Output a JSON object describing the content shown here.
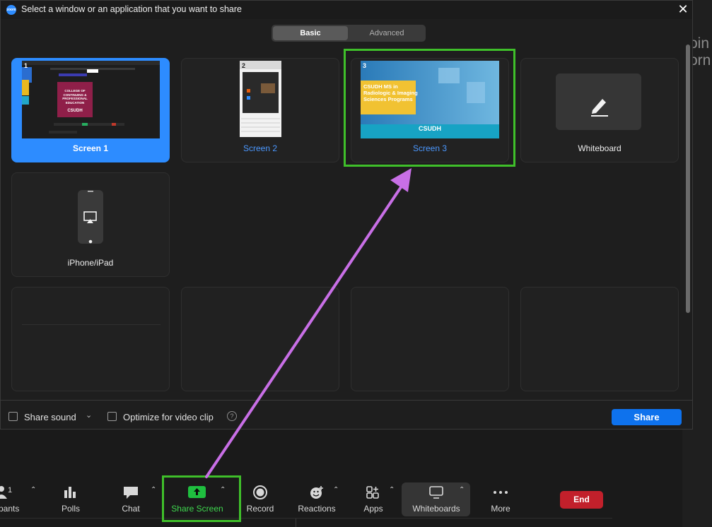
{
  "dialog": {
    "title": "Select a window or an application that you want to share",
    "app_icon_text": "zoom",
    "close_glyph": "✕",
    "tabs": [
      {
        "label": "Basic",
        "selected": true
      },
      {
        "label": "Advanced",
        "selected": false
      }
    ],
    "tiles": [
      {
        "label": "Screen 1",
        "number": "1",
        "selected": true
      },
      {
        "label": "Screen 2",
        "number": "2",
        "selected": false
      },
      {
        "label": "Screen 3",
        "number": "3",
        "selected": false
      },
      {
        "label": "Whiteboard",
        "selected": false
      },
      {
        "label": "iPhone/iPad",
        "selected": false
      }
    ],
    "screen1_thumb": {
      "slide_text": "COLLEGE OF CONTINUING & PROFESSIONAL EDUCATION",
      "logo": "CSUDH"
    },
    "screen3_thumb": {
      "headline": "CSUDH MS in Radiologic & Imaging Sciences Programs",
      "logo": "CSUDH"
    },
    "footer": {
      "share_sound_label": "Share sound",
      "share_sound_checked": false,
      "optimize_label": "Optimize for video clip",
      "optimize_checked": false,
      "help_glyph": "?",
      "share_button": "Share"
    }
  },
  "toolbar": {
    "participants_count": "1",
    "items": [
      {
        "label": "pants",
        "icon": "participants-icon"
      },
      {
        "label": "Polls",
        "icon": "polls-icon"
      },
      {
        "label": "Chat",
        "icon": "chat-icon"
      },
      {
        "label": "Share Screen",
        "icon": "share-screen-icon"
      },
      {
        "label": "Record",
        "icon": "record-icon"
      },
      {
        "label": "Reactions",
        "icon": "reactions-icon"
      },
      {
        "label": "Apps",
        "icon": "apps-icon"
      },
      {
        "label": "Whiteboards",
        "icon": "whiteboards-icon"
      },
      {
        "label": "More",
        "icon": "more-icon"
      }
    ],
    "end_label": "End"
  },
  "background_text": "oin\norn",
  "colors": {
    "accent_blue": "#2d8cff",
    "highlight_green": "#3fbf2a",
    "annotation_arrow": "#c86fe6",
    "end_red": "#c2202b",
    "share_green": "#1fbf3f"
  }
}
